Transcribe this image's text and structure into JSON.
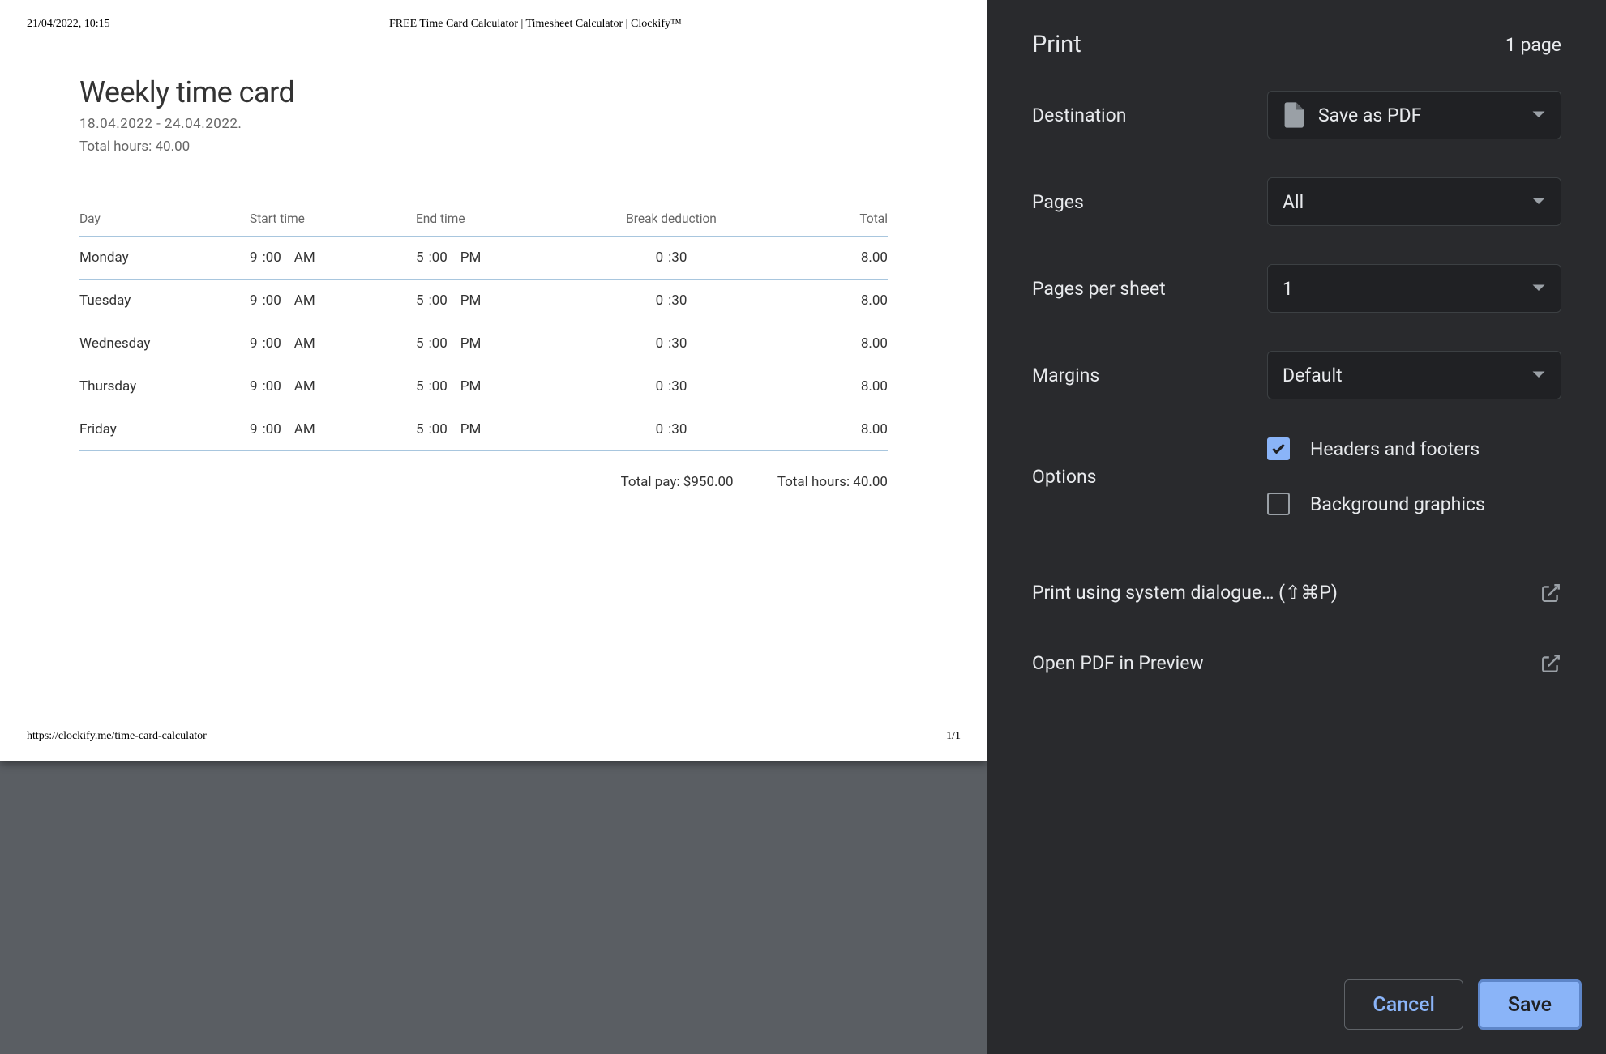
{
  "preview": {
    "header_left": "21/04/2022, 10:15",
    "header_center": "FREE Time Card Calculator | Timesheet Calculator | Clockify™",
    "title": "Weekly time card",
    "date_range": "18.04.2022 - 24.04.2022.",
    "total_hours_label": "Total hours: 40.00",
    "columns": {
      "day": "Day",
      "start": "Start time",
      "end": "End time",
      "break": "Break deduction",
      "total": "Total"
    },
    "rows": [
      {
        "day": "Monday",
        "start_h": "9",
        "start_m": ":00",
        "start_ampm": "AM",
        "end_h": "5",
        "end_m": ":00",
        "end_ampm": "PM",
        "break_h": "0",
        "break_m": ":30",
        "total": "8.00"
      },
      {
        "day": "Tuesday",
        "start_h": "9",
        "start_m": ":00",
        "start_ampm": "AM",
        "end_h": "5",
        "end_m": ":00",
        "end_ampm": "PM",
        "break_h": "0",
        "break_m": ":30",
        "total": "8.00"
      },
      {
        "day": "Wednesday",
        "start_h": "9",
        "start_m": ":00",
        "start_ampm": "AM",
        "end_h": "5",
        "end_m": ":00",
        "end_ampm": "PM",
        "break_h": "0",
        "break_m": ":30",
        "total": "8.00"
      },
      {
        "day": "Thursday",
        "start_h": "9",
        "start_m": ":00",
        "start_ampm": "AM",
        "end_h": "5",
        "end_m": ":00",
        "end_ampm": "PM",
        "break_h": "0",
        "break_m": ":30",
        "total": "8.00"
      },
      {
        "day": "Friday",
        "start_h": "9",
        "start_m": ":00",
        "start_ampm": "AM",
        "end_h": "5",
        "end_m": ":00",
        "end_ampm": "PM",
        "break_h": "0",
        "break_m": ":30",
        "total": "8.00"
      }
    ],
    "summary_pay": "Total pay: $950.00",
    "summary_hours": "Total hours: 40.00",
    "footer_url": "https://clockify.me/time-card-calculator",
    "footer_page": "1/1"
  },
  "sidebar": {
    "title": "Print",
    "page_count": "1 page",
    "labels": {
      "destination": "Destination",
      "pages": "Pages",
      "pages_per_sheet": "Pages per sheet",
      "margins": "Margins",
      "options": "Options"
    },
    "destination_value": "Save as PDF",
    "pages_value": "All",
    "pages_per_sheet_value": "1",
    "margins_value": "Default",
    "options": {
      "headers_footers": {
        "label": "Headers and footers",
        "checked": true
      },
      "bg_graphics": {
        "label": "Background graphics",
        "checked": false
      }
    },
    "links": {
      "system_dialog": "Print using system dialogue… (⇧⌘P)",
      "open_preview": "Open PDF in Preview"
    },
    "buttons": {
      "cancel": "Cancel",
      "save": "Save"
    }
  }
}
